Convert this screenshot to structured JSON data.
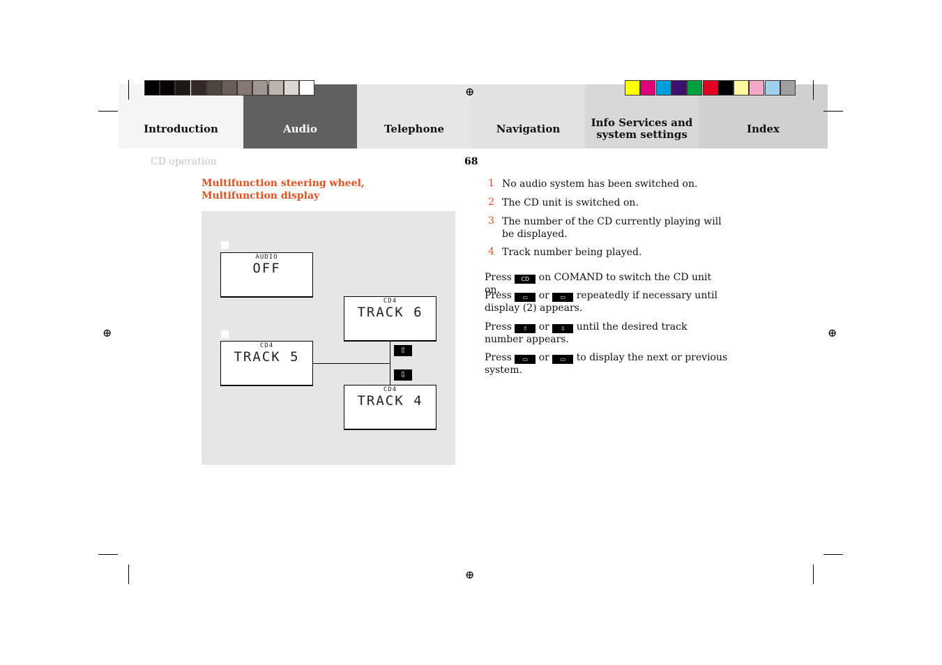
{
  "tabs": [
    {
      "label": "Introduction",
      "bg": "#f5f5f5",
      "color": "#111"
    },
    {
      "label": "Audio",
      "bg": "#606060",
      "color": "#ffffff",
      "active": true
    },
    {
      "label": "Telephone",
      "bg": "#e6e6e6",
      "color": "#111"
    },
    {
      "label": "Navigation",
      "bg": "#e2e2e2",
      "color": "#111"
    },
    {
      "label": "Info Services and system settings",
      "bg": "#d8d8d8",
      "color": "#111"
    },
    {
      "label": "Index",
      "bg": "#d0d0d0",
      "color": "#111"
    }
  ],
  "gray_swatches": [
    "#000000",
    "#070304",
    "#1e1816",
    "#332826",
    "#4f4540",
    "#6a5e57",
    "#857872",
    "#a19792",
    "#beb4ae",
    "#ddd7d3",
    "#ffffff"
  ],
  "color_swatches": [
    "#ffff00",
    "#e0007a",
    "#00a0e0",
    "#3c1070",
    "#00a040",
    "#e00020",
    "#000000",
    "#fffaa0",
    "#f4a8c8",
    "#a0d0f0",
    "#a0a0a0"
  ],
  "section": "CD operation",
  "page_number": "68",
  "heading": "Multifunction steering wheel, Multifunction display",
  "diagram": {
    "d1": {
      "small": "AUDIO",
      "big": "OFF"
    },
    "d2": {
      "small": "CD4",
      "big": "TRACK 5"
    },
    "d3": {
      "small": "CD4",
      "big": "TRACK 6"
    },
    "d4": {
      "small": "CD4",
      "big": "TRACK 4"
    },
    "up": "⇧",
    "down": "⇩"
  },
  "list": [
    {
      "n": "1",
      "text": "No audio system has been switched on."
    },
    {
      "n": "2",
      "text": "The CD unit is switched on."
    },
    {
      "n": "3",
      "text": "The number of the CD currently playing will be displayed."
    },
    {
      "n": "4",
      "text": "Track number being played."
    }
  ],
  "instructions": {
    "press": "Press",
    "or": "or",
    "cd_key": "CD",
    "p1": "on COMAND to switch the CD unit on.",
    "p2": "repeatedly if necessary until display (2) appears.",
    "p3": "until the desired track number appears.",
    "p4": "to display the next or previous system."
  }
}
